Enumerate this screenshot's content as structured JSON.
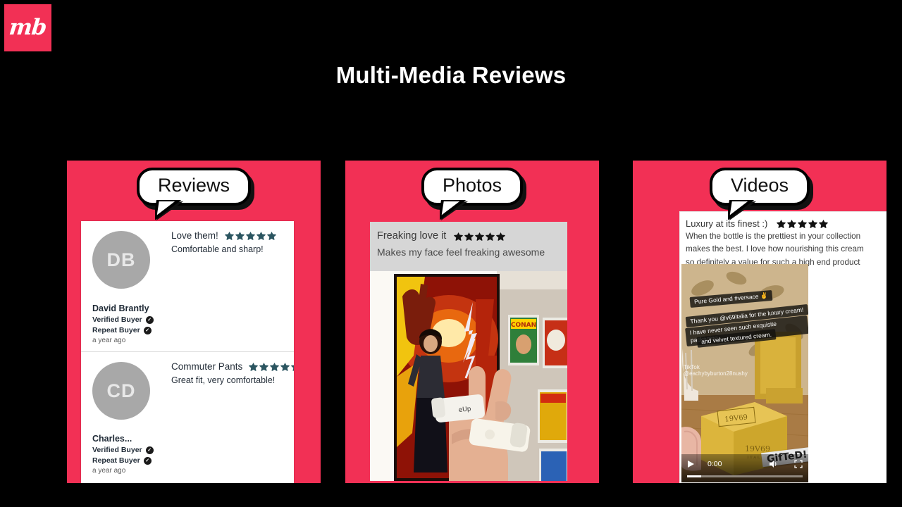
{
  "brand": {
    "logo_text": "mb",
    "logo_color": "#F23055"
  },
  "page": {
    "title": "Multi-Media Reviews",
    "background": "#000000",
    "accent": "#F23055"
  },
  "panels": [
    {
      "id": "reviews",
      "bubble_label": "Reviews",
      "star_color": "#2B5560",
      "reviews": [
        {
          "initials": "DB",
          "title": "Love them!",
          "stars": 5,
          "body": "Comfortable and sharp!",
          "name": "David Brantly",
          "badge_verified": "Verified Buyer",
          "badge_repeat": "Repeat Buyer",
          "time_ago": "a year ago"
        },
        {
          "initials": "CD",
          "title": "Commuter Pants",
          "stars": 5,
          "body": "Great fit, very comfortable!",
          "name": "Charles...",
          "badge_verified": "Verified Buyer",
          "badge_repeat": "Repeat Buyer",
          "time_ago": "a year ago"
        }
      ]
    },
    {
      "id": "photos",
      "bubble_label": "Photos",
      "star_color": "#111111",
      "review": {
        "title": "Freaking love it",
        "stars": 5,
        "body": "Makes my face feel freaking awesome"
      }
    },
    {
      "id": "videos",
      "bubble_label": "Videos",
      "star_color": "#111111",
      "review": {
        "title": "Luxury at its finest :)",
        "stars": 5,
        "line1": "When the bottle is the prettiest in your collection",
        "line2": "makes the best. I love how nourishing this cream",
        "line3": "so definitely a value for such a high end product"
      },
      "video": {
        "caption_1": "Pure Gold and  #versace  ✌",
        "caption_2": "Thank you @v69italia for the luxury cream!",
        "caption_3": "I have never seen such exquisite packaging",
        "caption_4": "and velvet textured cream.",
        "watermark": "TikTok",
        "watermark_handle": "@eachybyburton28nushy",
        "sticker": "GifTeD!",
        "current_time": "0:00",
        "play_icon": "play-icon",
        "volume_icon": "volume-icon",
        "fullscreen_icon": "fullscreen-icon"
      }
    }
  ]
}
